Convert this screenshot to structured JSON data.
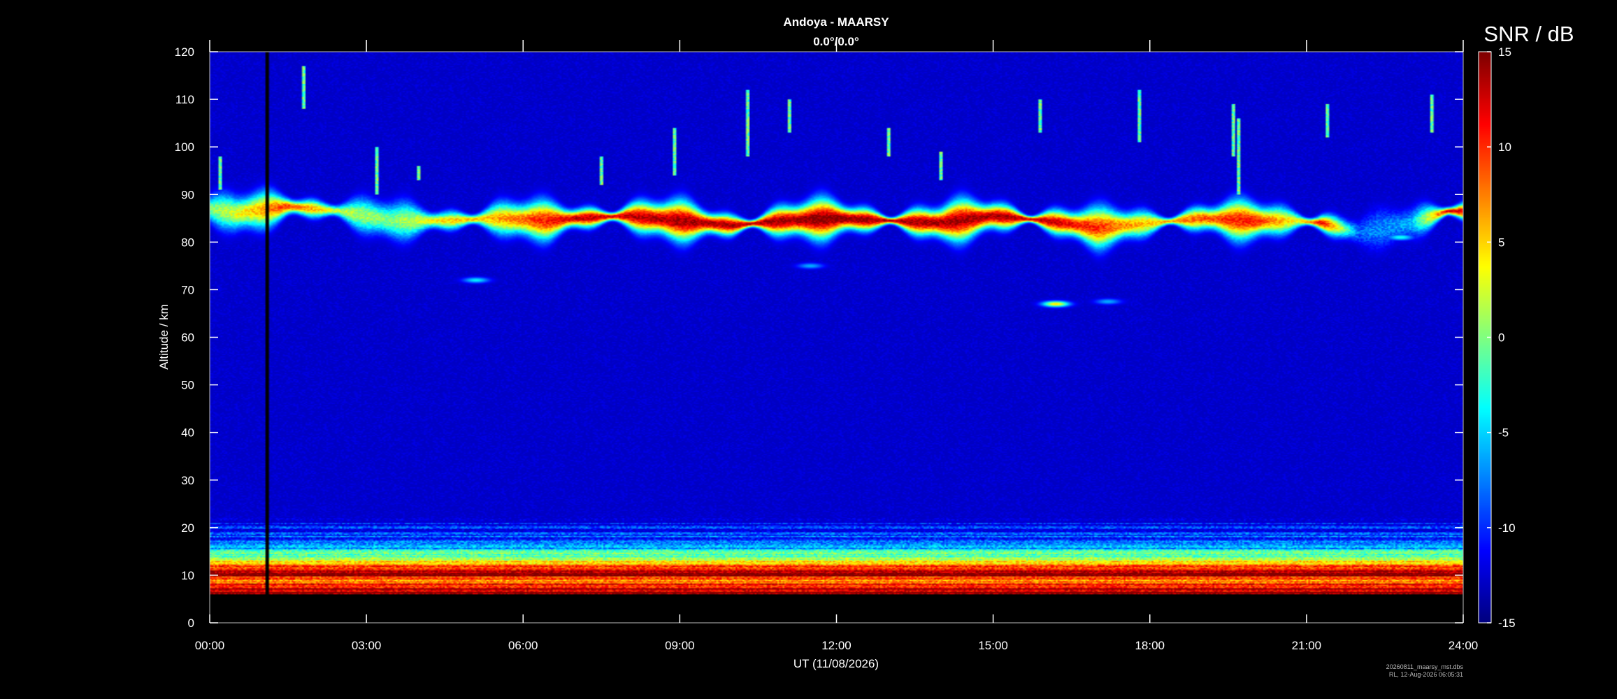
{
  "chart_data": {
    "type": "heatmap",
    "title": "Andoya - MAARSY",
    "subtitle": "0.0°/0.0°",
    "xlabel": "UT (11/08/2026)",
    "ylabel": "Altitude / km",
    "colorbar_label": "SNR / dB",
    "x_ticks": [
      "00:00",
      "03:00",
      "06:00",
      "09:00",
      "12:00",
      "15:00",
      "18:00",
      "21:00",
      "24:00"
    ],
    "xlim_hours": [
      0,
      24
    ],
    "y_ticks": [
      0,
      10,
      20,
      30,
      40,
      50,
      60,
      70,
      80,
      90,
      100,
      110,
      120
    ],
    "ylim": [
      0,
      120
    ],
    "colorbar_ticks": [
      15,
      10,
      5,
      0,
      -5,
      -10,
      -15
    ],
    "clim": [
      -15,
      15
    ],
    "colormap": "jet",
    "grid": false,
    "background_snr_db": -13,
    "data_gap": {
      "start_hour": 1.05,
      "end_hour": 1.15
    },
    "data_floor_km": 6,
    "pmse_layer": [
      {
        "hour": 0.0,
        "alt_km": 87.0,
        "strength_db": 0
      },
      {
        "hour": 0.5,
        "alt_km": 86.0,
        "strength_db": 3
      },
      {
        "hour": 1.5,
        "alt_km": 87.5,
        "strength_db": 10
      },
      {
        "hour": 2.5,
        "alt_km": 86.5,
        "strength_db": 2
      },
      {
        "hour": 3.5,
        "alt_km": 84.5,
        "strength_db": 0
      },
      {
        "hour": 4.5,
        "alt_km": 84.5,
        "strength_db": 5
      },
      {
        "hour": 5.5,
        "alt_km": 85.0,
        "strength_db": 6
      },
      {
        "hour": 6.5,
        "alt_km": 84.5,
        "strength_db": 11
      },
      {
        "hour": 7.0,
        "alt_km": 85.0,
        "strength_db": 13
      },
      {
        "hour": 8.0,
        "alt_km": 85.5,
        "strength_db": 13
      },
      {
        "hour": 9.0,
        "alt_km": 84.5,
        "strength_db": 14
      },
      {
        "hour": 10.0,
        "alt_km": 83.5,
        "strength_db": 14
      },
      {
        "hour": 11.0,
        "alt_km": 84.5,
        "strength_db": 14
      },
      {
        "hour": 12.0,
        "alt_km": 85.0,
        "strength_db": 15
      },
      {
        "hour": 13.0,
        "alt_km": 84.5,
        "strength_db": 14
      },
      {
        "hour": 14.0,
        "alt_km": 84.0,
        "strength_db": 14
      },
      {
        "hour": 15.0,
        "alt_km": 85.5,
        "strength_db": 14
      },
      {
        "hour": 16.0,
        "alt_km": 84.5,
        "strength_db": 13
      },
      {
        "hour": 17.0,
        "alt_km": 83.0,
        "strength_db": 10
      },
      {
        "hour": 18.0,
        "alt_km": 84.0,
        "strength_db": 5
      },
      {
        "hour": 19.0,
        "alt_km": 85.0,
        "strength_db": 9
      },
      {
        "hour": 20.0,
        "alt_km": 84.5,
        "strength_db": 11
      },
      {
        "hour": 20.8,
        "alt_km": 84.5,
        "strength_db": 3
      },
      {
        "hour": 21.3,
        "alt_km": 84.0,
        "strength_db": 12
      },
      {
        "hour": 22.0,
        "alt_km": 82.0,
        "strength_db": -8
      },
      {
        "hour": 23.0,
        "alt_km": 84.0,
        "strength_db": -6
      },
      {
        "hour": 23.7,
        "alt_km": 86.5,
        "strength_db": 12
      },
      {
        "hour": 24.0,
        "alt_km": 86.5,
        "strength_db": 12
      }
    ],
    "low_altitude_echo_profile": [
      {
        "alt_km": 6,
        "snr_db": 15
      },
      {
        "alt_km": 7,
        "snr_db": 14
      },
      {
        "alt_km": 8,
        "snr_db": 11
      },
      {
        "alt_km": 9,
        "snr_db": 7
      },
      {
        "alt_km": 10,
        "snr_db": 13
      },
      {
        "alt_km": 11,
        "snr_db": 12
      },
      {
        "alt_km": 12,
        "snr_db": 7
      },
      {
        "alt_km": 13,
        "snr_db": 3
      },
      {
        "alt_km": 14,
        "snr_db": 0
      },
      {
        "alt_km": 15,
        "snr_db": -3
      },
      {
        "alt_km": 16,
        "snr_db": -6
      },
      {
        "alt_km": 17,
        "snr_db": -8
      },
      {
        "alt_km": 18,
        "snr_db": -10
      },
      {
        "alt_km": 20,
        "snr_db": -11
      },
      {
        "alt_km": 21,
        "snr_db": -12
      },
      {
        "alt_km": 22,
        "snr_db": -13
      }
    ],
    "small_echo_patches": [
      {
        "hour": 16.2,
        "alt_km": 67.0,
        "snr_db": 5
      },
      {
        "hour": 17.2,
        "alt_km": 67.5,
        "snr_db": -6
      },
      {
        "hour": 5.1,
        "alt_km": 72.0,
        "snr_db": -4
      },
      {
        "hour": 11.5,
        "alt_km": 75.0,
        "snr_db": -6
      },
      {
        "hour": 22.8,
        "alt_km": 81.0,
        "snr_db": -3
      }
    ],
    "meteor_streaks": [
      {
        "hour": 1.8,
        "alt_top_km": 117,
        "alt_bottom_km": 108
      },
      {
        "hour": 3.2,
        "alt_top_km": 100,
        "alt_bottom_km": 90
      },
      {
        "hour": 4.0,
        "alt_top_km": 96,
        "alt_bottom_km": 93
      },
      {
        "hour": 8.9,
        "alt_top_km": 104,
        "alt_bottom_km": 94
      },
      {
        "hour": 10.3,
        "alt_top_km": 112,
        "alt_bottom_km": 98
      },
      {
        "hour": 11.1,
        "alt_top_km": 110,
        "alt_bottom_km": 103
      },
      {
        "hour": 13.0,
        "alt_top_km": 104,
        "alt_bottom_km": 98
      },
      {
        "hour": 15.9,
        "alt_top_km": 110,
        "alt_bottom_km": 103
      },
      {
        "hour": 17.8,
        "alt_top_km": 112,
        "alt_bottom_km": 101
      },
      {
        "hour": 19.6,
        "alt_top_km": 109,
        "alt_bottom_km": 98
      },
      {
        "hour": 19.7,
        "alt_top_km": 106,
        "alt_bottom_km": 90
      },
      {
        "hour": 21.4,
        "alt_top_km": 109,
        "alt_bottom_km": 102
      },
      {
        "hour": 23.4,
        "alt_top_km": 111,
        "alt_bottom_km": 103
      },
      {
        "hour": 0.2,
        "alt_top_km": 98,
        "alt_bottom_km": 91
      },
      {
        "hour": 14.0,
        "alt_top_km": 99,
        "alt_bottom_km": 93
      },
      {
        "hour": 7.5,
        "alt_top_km": 98,
        "alt_bottom_km": 92
      }
    ]
  },
  "footer": {
    "line1": "20260811_maarsy_mst.dbs",
    "line2": "RL, 12-Aug-2026 06:05:31"
  }
}
